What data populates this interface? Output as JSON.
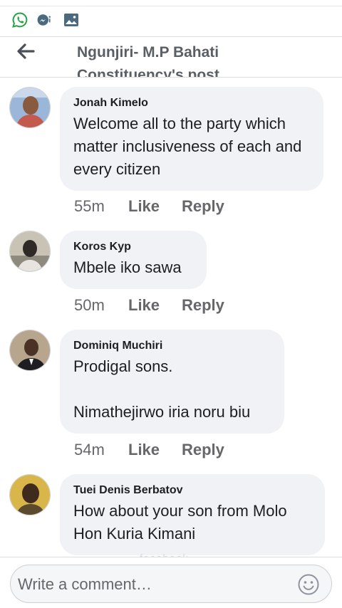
{
  "header": {
    "post_title": "Ngunjiri- M.P Bahati Constituency's post"
  },
  "status_icons": [
    "whatsapp-icon",
    "messenger-icon",
    "gallery-icon"
  ],
  "comments": [
    {
      "author": "Jonah Kimelo",
      "text": "Welcome all to the party which matter inclusiveness of each and every citizen",
      "time": "55m",
      "like": "Like",
      "reply": "Reply"
    },
    {
      "author": "Koros Kyp",
      "text": "Mbele iko sawa",
      "time": "50m",
      "like": "Like",
      "reply": "Reply"
    },
    {
      "author": "Dominiq Muchiri",
      "text": "Prodigal sons.\n\nNimathejirwo iria noru biu",
      "time": "54m",
      "like": "Like",
      "reply": "Reply"
    },
    {
      "author": "Tuei Denis Berbatov",
      "text": "How about your son from Molo Hon Kuria Kimani"
    }
  ],
  "composer": {
    "placeholder": "Write a comment…"
  },
  "footer_faded_label": "facebook",
  "colors": {
    "bubble": "#f0f2f5",
    "meta": "#65676b",
    "title": "#5a5f66",
    "whatsapp_green": "#25a244"
  }
}
